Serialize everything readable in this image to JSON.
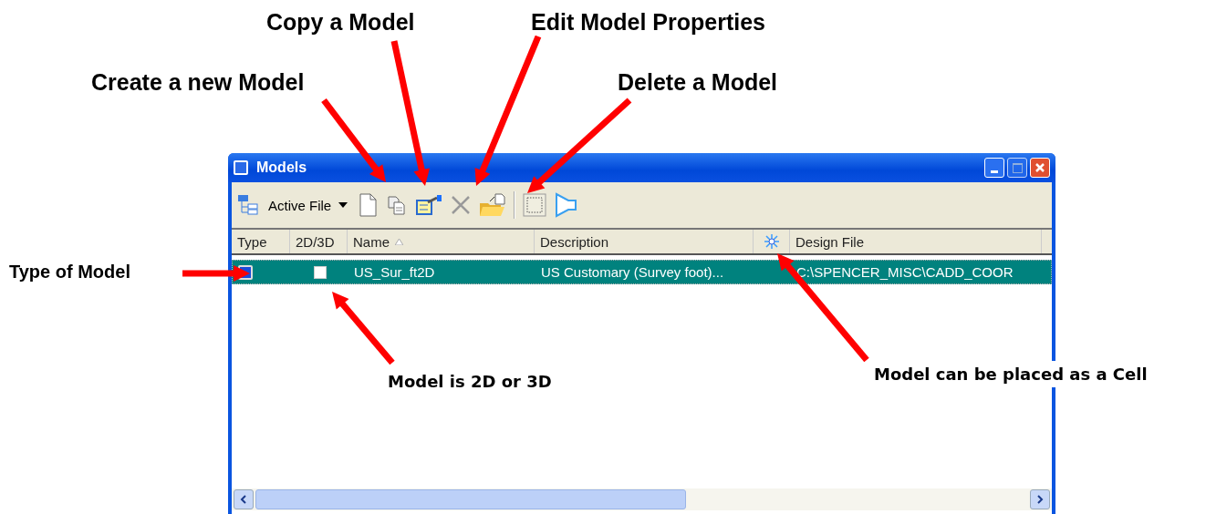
{
  "callouts": [
    {
      "text": "Copy a Model",
      "kind": "top"
    },
    {
      "text": "Edit Model Properties",
      "kind": "top"
    },
    {
      "text": "Create a new Model",
      "kind": "top"
    },
    {
      "text": "Delete a Model",
      "kind": "top"
    },
    {
      "text": "Type of Model",
      "kind": "side"
    },
    {
      "text": "Model is 2D or 3D",
      "kind": "bottom"
    },
    {
      "text": "Model can be placed as a Cell",
      "kind": "bottom"
    }
  ],
  "window": {
    "title": "Models"
  },
  "toolbar": {
    "dropdown": "Active File"
  },
  "columns": [
    {
      "label": "Type",
      "kind": "text"
    },
    {
      "label": "2D/3D",
      "kind": "text"
    },
    {
      "label": "Name",
      "kind": "sorted"
    },
    {
      "label": "Description",
      "kind": "text"
    },
    {
      "kind": "cell-icon"
    },
    {
      "label": "Design File",
      "kind": "text"
    }
  ],
  "rows": [
    {
      "selected": true,
      "checked": false,
      "name": "US_Sur_ft2D",
      "description": "US Customary (Survey foot)...",
      "design_file": "C:\\SPENCER_MISC\\CADD_COOR"
    }
  ]
}
